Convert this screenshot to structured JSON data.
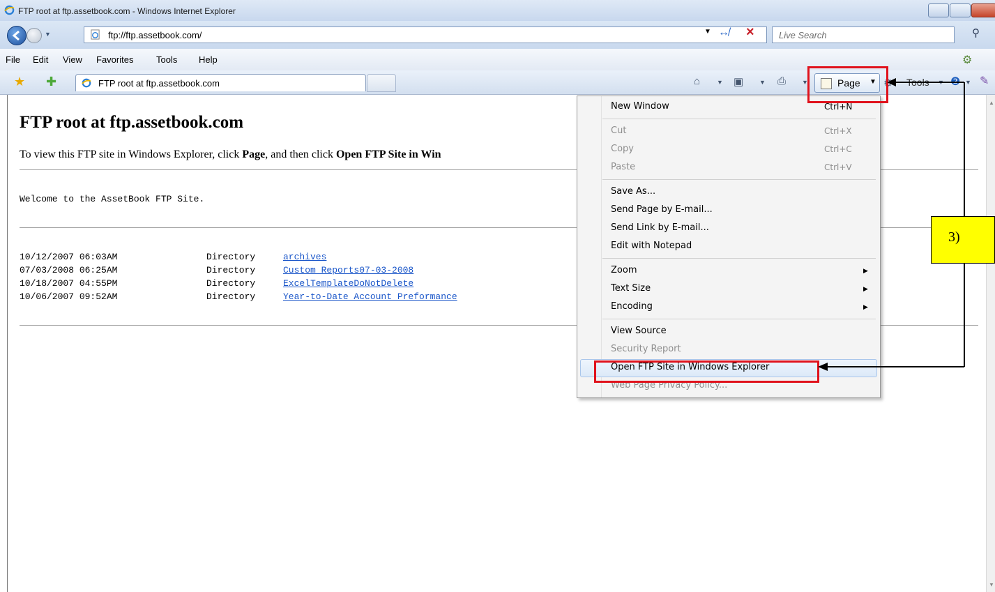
{
  "window": {
    "title": "FTP root at ftp.assetbook.com - Windows Internet Explorer"
  },
  "address_bar": {
    "url": "ftp://ftp.assetbook.com/",
    "search_placeholder": "Live Search"
  },
  "menubar": {
    "items": [
      "File",
      "Edit",
      "View",
      "Favorites",
      "Tools",
      "Help"
    ]
  },
  "commandbar": {
    "tab_title": "FTP root at ftp.assetbook.com",
    "page_button": "Page",
    "tools_button": "Tools"
  },
  "content": {
    "heading": "FTP root at ftp.assetbook.com",
    "instruction_prefix": "To view this FTP site in Windows Explorer, click ",
    "instruction_bold1": "Page",
    "instruction_middle": ", and then click ",
    "instruction_bold2": "Open FTP Site in Win",
    "welcome": "Welcome to the AssetBook FTP Site.",
    "listing": [
      {
        "date": "10/12/2007 06:03AM",
        "type": "Directory",
        "name": "archives"
      },
      {
        "date": "07/03/2008 06:25AM",
        "type": "Directory",
        "name": "Custom Reports07-03-2008"
      },
      {
        "date": "10/18/2007 04:55PM",
        "type": "Directory",
        "name": "ExcelTemplateDoNotDelete"
      },
      {
        "date": "10/06/2007 09:52AM",
        "type": "Directory",
        "name": "Year-to-Date Account Preformance"
      }
    ]
  },
  "page_menu": {
    "new_window": "New Window",
    "new_window_shortcut": "Ctrl+N",
    "cut": "Cut",
    "cut_shortcut": "Ctrl+X",
    "copy": "Copy",
    "copy_shortcut": "Ctrl+C",
    "paste": "Paste",
    "paste_shortcut": "Ctrl+V",
    "save_as": "Save As...",
    "send_page": "Send Page by E-mail...",
    "send_link": "Send Link by E-mail...",
    "edit_notepad": "Edit with Notepad",
    "zoom": "Zoom",
    "text_size": "Text Size",
    "encoding": "Encoding",
    "view_source": "View Source",
    "security_report": "Security Report",
    "open_ftp": "Open FTP Site in Windows Explorer",
    "privacy_policy": "Web Page Privacy Policy..."
  },
  "annotation": {
    "step_label": "3)"
  }
}
